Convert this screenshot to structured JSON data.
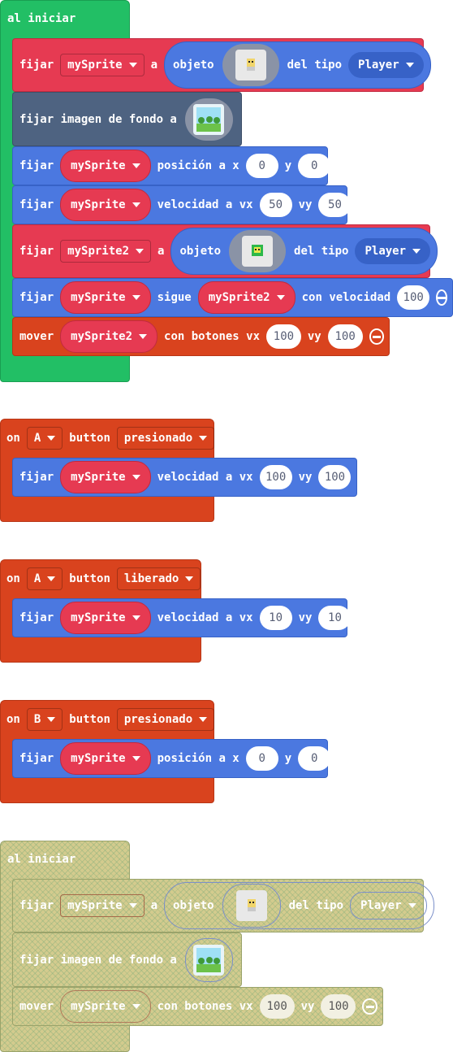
{
  "block1": {
    "hat": "al iniciar",
    "r1": {
      "fijar": "fijar",
      "var": "mySprite",
      "a": "a",
      "objeto": "objeto",
      "del_tipo": "del tipo",
      "kind": "Player"
    },
    "r2": {
      "label": "fijar imagen de fondo a"
    },
    "r3": {
      "fijar": "fijar",
      "var": "mySprite",
      "mid": "posición a x",
      "x": "0",
      "y_lbl": "y",
      "y": "0"
    },
    "r4": {
      "fijar": "fijar",
      "var": "mySprite",
      "mid": "velocidad a vx",
      "vx": "50",
      "vy_lbl": "vy",
      "vy": "50"
    },
    "r5": {
      "fijar": "fijar",
      "var": "mySprite2",
      "a": "a",
      "objeto": "objeto",
      "del_tipo": "del tipo",
      "kind": "Player"
    },
    "r6": {
      "fijar": "fijar",
      "var": "mySprite",
      "sigue": "sigue",
      "var2": "mySprite2",
      "con": "con velocidad",
      "val": "100"
    },
    "r7": {
      "mover": "mover",
      "var": "mySprite2",
      "mid": "con botones vx",
      "vx": "100",
      "vy_lbl": "vy",
      "vy": "100"
    }
  },
  "block2": {
    "on": "on",
    "btn": "A",
    "button": "button",
    "event": "presionado",
    "row": {
      "fijar": "fijar",
      "var": "mySprite",
      "mid": "velocidad a vx",
      "vx": "100",
      "vy_lbl": "vy",
      "vy": "100"
    }
  },
  "block3": {
    "on": "on",
    "btn": "A",
    "button": "button",
    "event": "liberado",
    "row": {
      "fijar": "fijar",
      "var": "mySprite",
      "mid": "velocidad a vx",
      "vx": "10",
      "vy_lbl": "vy",
      "vy": "10"
    }
  },
  "block4": {
    "on": "on",
    "btn": "B",
    "button": "button",
    "event": "presionado",
    "row": {
      "fijar": "fijar",
      "var": "mySprite",
      "mid": "posición a x",
      "x": "0",
      "y_lbl": "y",
      "y": "0"
    }
  },
  "block5": {
    "hat": "al iniciar",
    "r1": {
      "fijar": "fijar",
      "var": "mySprite",
      "a": "a",
      "objeto": "objeto",
      "del_tipo": "del tipo",
      "kind": "Player"
    },
    "r2": {
      "label": "fijar imagen de fondo a"
    },
    "r3": {
      "mover": "mover",
      "var": "mySprite",
      "mid": "con botones vx",
      "vx": "100",
      "vy_lbl": "vy",
      "vy": "100"
    }
  }
}
